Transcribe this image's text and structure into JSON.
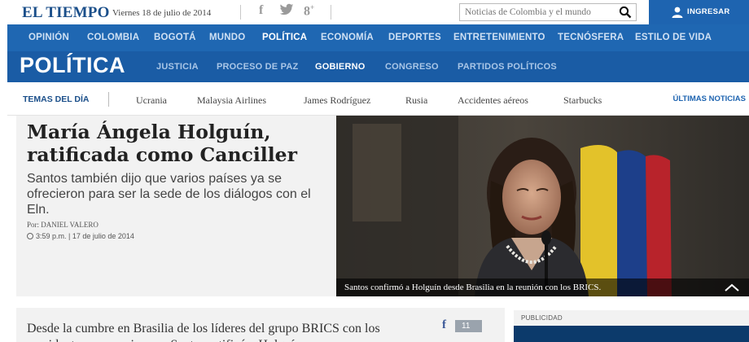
{
  "header": {
    "logo": "EL TIEMPO",
    "date": "Viernes 18 de julio de 2014",
    "social_icons": [
      "facebook-icon",
      "twitter-icon",
      "google-plus-icon"
    ],
    "search_placeholder": "Noticias de Colombia y el mundo",
    "login_label": "INGRESAR"
  },
  "main_nav": {
    "items": [
      "OPINIÓN",
      "COLOMBIA",
      "BOGOTÁ",
      "MUNDO",
      "POLÍTICA",
      "ECONOMÍA",
      "DEPORTES",
      "ENTRETENIMIENTO",
      "TECNÓSFERA",
      "ESTILO DE VIDA"
    ],
    "active": "POLÍTICA"
  },
  "section": {
    "title": "POLÍTICA",
    "subsections": [
      "JUSTICIA",
      "PROCESO DE PAZ",
      "GOBIERNO",
      "CONGRESO",
      "PARTIDOS POLÍTICOS"
    ],
    "active": "GOBIERNO"
  },
  "topics": {
    "label": "TEMAS DEL DÍA",
    "items": [
      "Ucrania",
      "Malaysia Airlines",
      "James Rodríguez",
      "Rusia",
      "Accidentes aéreos",
      "Starbucks"
    ],
    "latest_label": "ÚLTIMAS NOTICIAS"
  },
  "article": {
    "headline": "María Ángela Holguín, ratificada como Canciller",
    "subhead": "Santos también dijo que varios países ya se ofrecieron para ser la sede de los diálogos con el Eln.",
    "byline": "Por: DANIEL VALERO",
    "time": "3:59 p.m. | 17 de julio de 2014",
    "photo_caption": "Santos confirmó a Holguín desde Brasilia en la reunión con los BRICS.",
    "body_start": "Desde la cumbre en Brasilia de los líderes del grupo BRICS con los presidentes suramericanos, Santos ratificó a Holguín"
  },
  "share": {
    "facebook_count": "11"
  },
  "ad": {
    "label": "PUBLICIDAD"
  },
  "colors": {
    "brand_blue": "#1f67b2",
    "section_blue": "#1a5ca5",
    "logo_blue": "#1b4f8a"
  }
}
